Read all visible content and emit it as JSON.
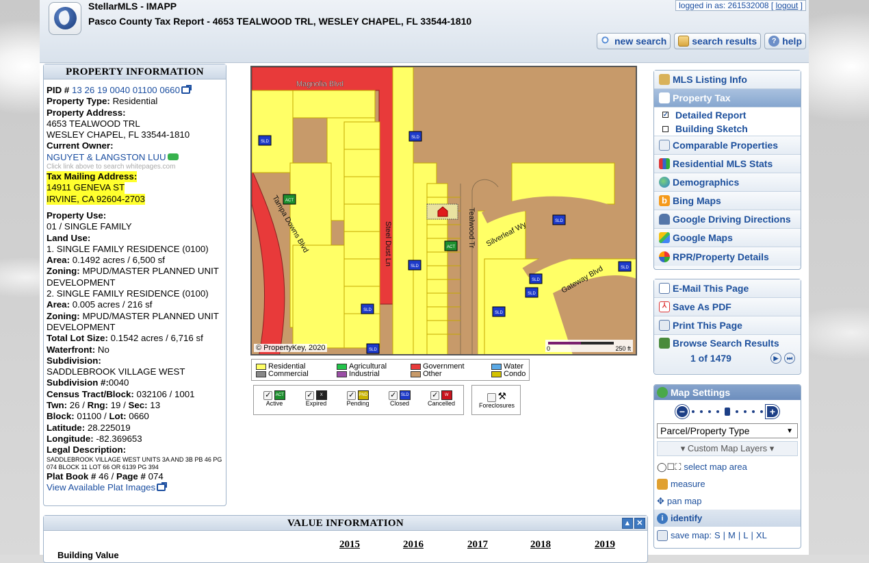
{
  "header": {
    "app_name": "StellarMLS - IMAPP",
    "report_title": "Pasco County Tax Report - 4653 TEALWOOD TRL, WESLEY CHAPEL, FL 33544-1810",
    "login_prefix": "logged in as: 261532008 [",
    "logout_label": "logout",
    "login_suffix": "]",
    "buttons": {
      "new_search": "new search",
      "search_results": "search results",
      "help": "help"
    }
  },
  "property": {
    "title": "PROPERTY INFORMATION",
    "pid_label": "PID #",
    "pid_value": "13 26 19 0040 01100 0660",
    "type_label": "Property Type:",
    "type_value": "Residential",
    "address_label": "Property Address:",
    "address_line1": "4653 TEALWOOD TRL",
    "address_line2": "WESLEY CHAPEL, FL 33544-1810",
    "owner_label": "Current Owner:",
    "owner_value": "NGUYET & LANGSTON LUU",
    "owner_note": "Click link above to search whitepages.com",
    "mailing_label": "Tax Mailing Address:",
    "mailing_line1": "14911 GENEVA ST",
    "mailing_line2": "IRVINE, CA 92604-2703",
    "use_label": "Property Use:",
    "use_value": "01 / SINGLE FAMILY",
    "landuse_label": "Land Use:",
    "landuse1": "1. SINGLE FAMILY RESIDENCE (0100)",
    "area_label": "Area:",
    "area1": "0.1492 acres / 6,500 sf",
    "zoning_label": "Zoning:",
    "zoning1": "MPUD/MASTER PLANNED UNIT DEVELOPMENT",
    "landuse2": "2. SINGLE FAMILY RESIDENCE (0100)",
    "area2": "0.005 acres / 216 sf",
    "zoning2": "MPUD/MASTER PLANNED UNIT DEVELOPMENT",
    "lot_label": "Total Lot Size:",
    "lot_value": "0.1542 acres / 6,716 sf",
    "water_label": "Waterfront:",
    "water_value": "No",
    "subdiv_label": "Subdivision:",
    "subdiv_value": "SADDLEBROOK VILLAGE WEST",
    "subdivnum_label": "Subdivision #:",
    "subdivnum_value": "0040",
    "census_label": "Census Tract/Block:",
    "census_value": "032106 / 1001",
    "twn_label": "Twn:",
    "twn_value": "26",
    "rng_label": "Rng:",
    "rng_value": "19",
    "sec_label": "Sec:",
    "sec_value": "13",
    "block_label": "Block:",
    "block_value": "01100",
    "lotno_label": "Lot:",
    "lotno_value": "0660",
    "lat_label": "Latitude:",
    "lat_value": "28.225019",
    "lon_label": "Longitude:",
    "lon_value": "-82.369653",
    "legal_label": "Legal Description:",
    "legal_value": "SADDLEBROOK VILLAGE WEST UNITS 3A AND 3B PB 46 PG 074 BLOCK 11 LOT 66 OR 6139 PG 394",
    "platbook_label": "Plat Book #",
    "platbook_value": "46",
    "page_label": "Page #",
    "page_value": "074",
    "plat_link": "View Available Plat Images"
  },
  "map": {
    "streets": [
      "Magnolia Blvd",
      "Tampa Downs Blvd",
      "Steel Dust Ln",
      "Tealwood Tr",
      "Silverleaf Wy",
      "Gateway Blvd"
    ],
    "copyright": "© PropertyKey, 2020",
    "scale_start": "0",
    "scale_end": "250 ft",
    "flag_labels": {
      "sold": "SLD",
      "active": "ACT"
    }
  },
  "legend": {
    "items": [
      {
        "label": "Residential",
        "color": "#ffff66"
      },
      {
        "label": "Commercial",
        "color": "#888888"
      },
      {
        "label": "Agricultural",
        "color": "#22c34a"
      },
      {
        "label": "Industrial",
        "color": "#9b4ea6"
      },
      {
        "label": "Government",
        "color": "#e83a3a"
      },
      {
        "label": "Other",
        "color": "#c79a6a"
      },
      {
        "label": "Water",
        "color": "#5aa9e6"
      },
      {
        "label": "Condo",
        "color": "#d4c200"
      }
    ]
  },
  "statuses": [
    {
      "label": "Active",
      "flag": "ACT",
      "color": "#1d8f2e"
    },
    {
      "label": "Expired",
      "flag": "X",
      "color": "#222222"
    },
    {
      "label": "Pending",
      "flag": "PND",
      "color": "#c9b300"
    },
    {
      "label": "Closed",
      "flag": "SLD",
      "color": "#1d3ac9"
    },
    {
      "label": "Cancelled",
      "flag": "W",
      "color": "#c9141e"
    }
  ],
  "foreclosures_label": "Foreclosures",
  "sidebar": {
    "nav": [
      "MLS Listing Info",
      "Property Tax",
      "Detailed Report",
      "Building Sketch",
      "Comparable Properties",
      "Residential MLS Stats",
      "Demographics",
      "Bing Maps",
      "Google Driving Directions",
      "Google Maps",
      "RPR/Property Details"
    ],
    "actions": [
      "E-Mail This Page",
      "Save As PDF",
      "Print This Page",
      "Browse Search Results"
    ],
    "browse_count": "1 of 1479"
  },
  "map_settings": {
    "title": "Map Settings",
    "layer_select": "Parcel/Property Type",
    "custom_layers": "Custom Map Layers",
    "select_area": "select map area",
    "measure": "measure",
    "pan": "pan map",
    "identify": "identify",
    "save_map_prefix": "save map:",
    "save_sizes": [
      "S",
      "M",
      "L",
      "XL"
    ]
  },
  "value": {
    "title": "VALUE INFORMATION",
    "years": [
      "2015",
      "2016",
      "2017",
      "2018",
      "2019"
    ],
    "row_label": "Building Value"
  }
}
